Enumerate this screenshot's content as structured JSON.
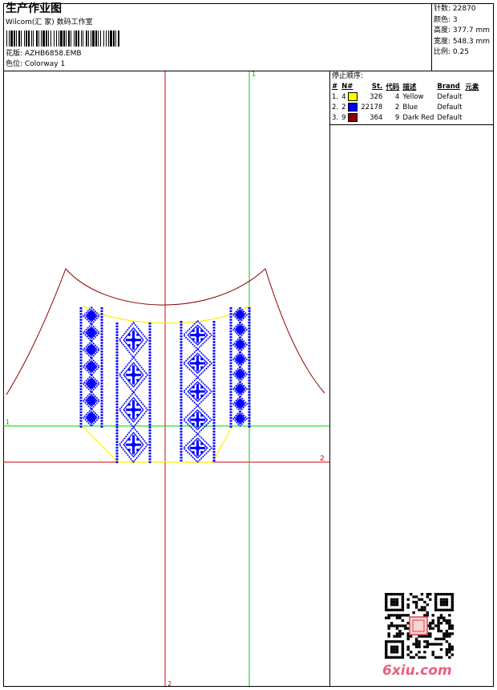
{
  "header": {
    "title": "生产作业图",
    "company": "Wilcom(汇 家) 数码工作室",
    "design_line": "花版: AZHB6858.EMB",
    "colorway_line": "色位: Colorway 1"
  },
  "stats": {
    "stitches": "针数: 22870",
    "colors": "颜色: 3",
    "height": "高度: 377.7 mm",
    "width": "宽度: 548.3 mm",
    "scale": "比例: 0.25"
  },
  "stop_sequence": {
    "title": "停止顺序:",
    "columns": [
      "#",
      "N#",
      "St.",
      "代码",
      "描述",
      "Brand",
      "元素"
    ],
    "rows": [
      {
        "num": "1.",
        "needle": "4",
        "color": "#FFFF00",
        "stitches": "326",
        "code": "4",
        "desc": "Yellow",
        "brand": "Default"
      },
      {
        "num": "2.",
        "needle": "2",
        "color": "#0000FF",
        "stitches": "22178",
        "code": "2",
        "desc": "Blue",
        "brand": "Default"
      },
      {
        "num": "3.",
        "needle": "9",
        "color": "#8B0000",
        "stitches": "364",
        "code": "9",
        "desc": "Dark Red",
        "brand": "Default"
      }
    ]
  },
  "guides": {
    "green_v": "1",
    "green_h": "1",
    "red_h": "2",
    "red_v": "2"
  },
  "colors": {
    "guide_red": "#d40000",
    "guide_green": "#00cc00",
    "outline": "#8b0000",
    "embroidery": "#0000ff",
    "yellow": "#ffee00"
  },
  "watermark": "6xiu.com",
  "icons": [
    "qr-code-icon",
    "barcode-icon"
  ]
}
